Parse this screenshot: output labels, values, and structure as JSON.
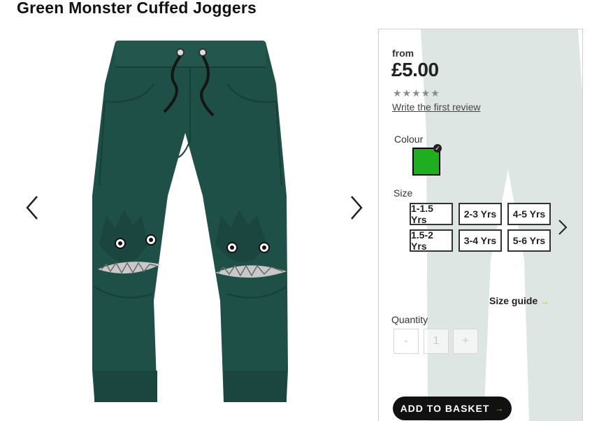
{
  "product": {
    "title": "Green Monster Cuffed Joggers"
  },
  "gallery": {
    "prev_icon": "chevron-left-icon",
    "next_icon": "chevron-right-icon",
    "colors": {
      "fabric": "#1f5048",
      "fabric_shadow": "#173f39",
      "teeth": "#c8c8c8"
    }
  },
  "pricing": {
    "from_label": "from",
    "price": "£5.00"
  },
  "reviews": {
    "stars": "★★★★★",
    "write_review": "Write the first review"
  },
  "colour": {
    "label": "Colour",
    "selected_swatch": "#1fae1f",
    "check_icon": "check-icon"
  },
  "size": {
    "label": "Size",
    "options": [
      "1-1.5 Yrs",
      "2-3 Yrs",
      "4-5 Yrs",
      "1.5-2 Yrs",
      "3-4 Yrs",
      "5-6 Yrs"
    ],
    "guide": "Size guide",
    "next_icon": "chevron-right-icon"
  },
  "quantity": {
    "label": "Quantity",
    "minus": "-",
    "value": "1",
    "plus": "+"
  },
  "basket": {
    "label": "ADD TO BASKET",
    "accent": "#e0b000"
  }
}
